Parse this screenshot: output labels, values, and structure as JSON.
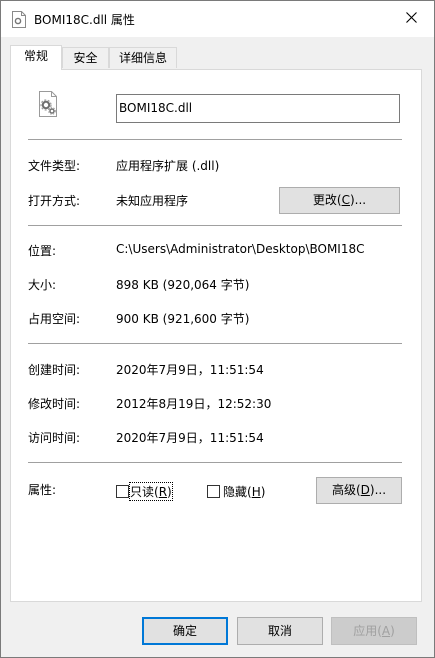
{
  "window": {
    "title": "BOMI18C.dll 属性",
    "close_icon": "close-icon",
    "file_icon": "dll-gear-file-icon"
  },
  "tabs": [
    {
      "label": "常规",
      "active": true
    },
    {
      "label": "安全",
      "active": false
    },
    {
      "label": "详细信息",
      "active": false
    }
  ],
  "general": {
    "filename": "BOMI18C.dll",
    "file_type": {
      "label": "文件类型:",
      "value": "应用程序扩展 (.dll)"
    },
    "opens_with": {
      "label": "打开方式:",
      "value": "未知应用程序",
      "change_button": "更改(",
      "change_key": "C",
      "change_suffix": ")..."
    },
    "location": {
      "label": "位置:",
      "value": "C:\\Users\\Administrator\\Desktop\\BOMI18C"
    },
    "size": {
      "label": "大小:",
      "value": "898 KB (920,064 字节)"
    },
    "size_on_disk": {
      "label": "占用空间:",
      "value": "900 KB (921,600 字节)"
    },
    "created": {
      "label": "创建时间:",
      "value": "2020年7月9日，11:51:54"
    },
    "modified": {
      "label": "修改时间:",
      "value": "2012年8月19日，12:52:30"
    },
    "accessed": {
      "label": "访问时间:",
      "value": "2020年7月9日，11:51:54"
    },
    "attributes": {
      "label": "属性:",
      "readonly": {
        "label": "只读(",
        "key": "R",
        "suffix": ")",
        "checked": false
      },
      "hidden": {
        "label": "隐藏(",
        "key": "H",
        "suffix": ")",
        "checked": false
      },
      "advanced_button": "高级(",
      "advanced_key": "D",
      "advanced_suffix": ")..."
    }
  },
  "footer": {
    "ok": "确定",
    "cancel": "取消",
    "apply": "应用(",
    "apply_key": "A",
    "apply_suffix": ")"
  },
  "colors": {
    "accent": "#0078d7",
    "window_bg": "#f0f0f0",
    "button_bg": "#e1e1e1",
    "disabled_text": "#a0a0a0"
  }
}
